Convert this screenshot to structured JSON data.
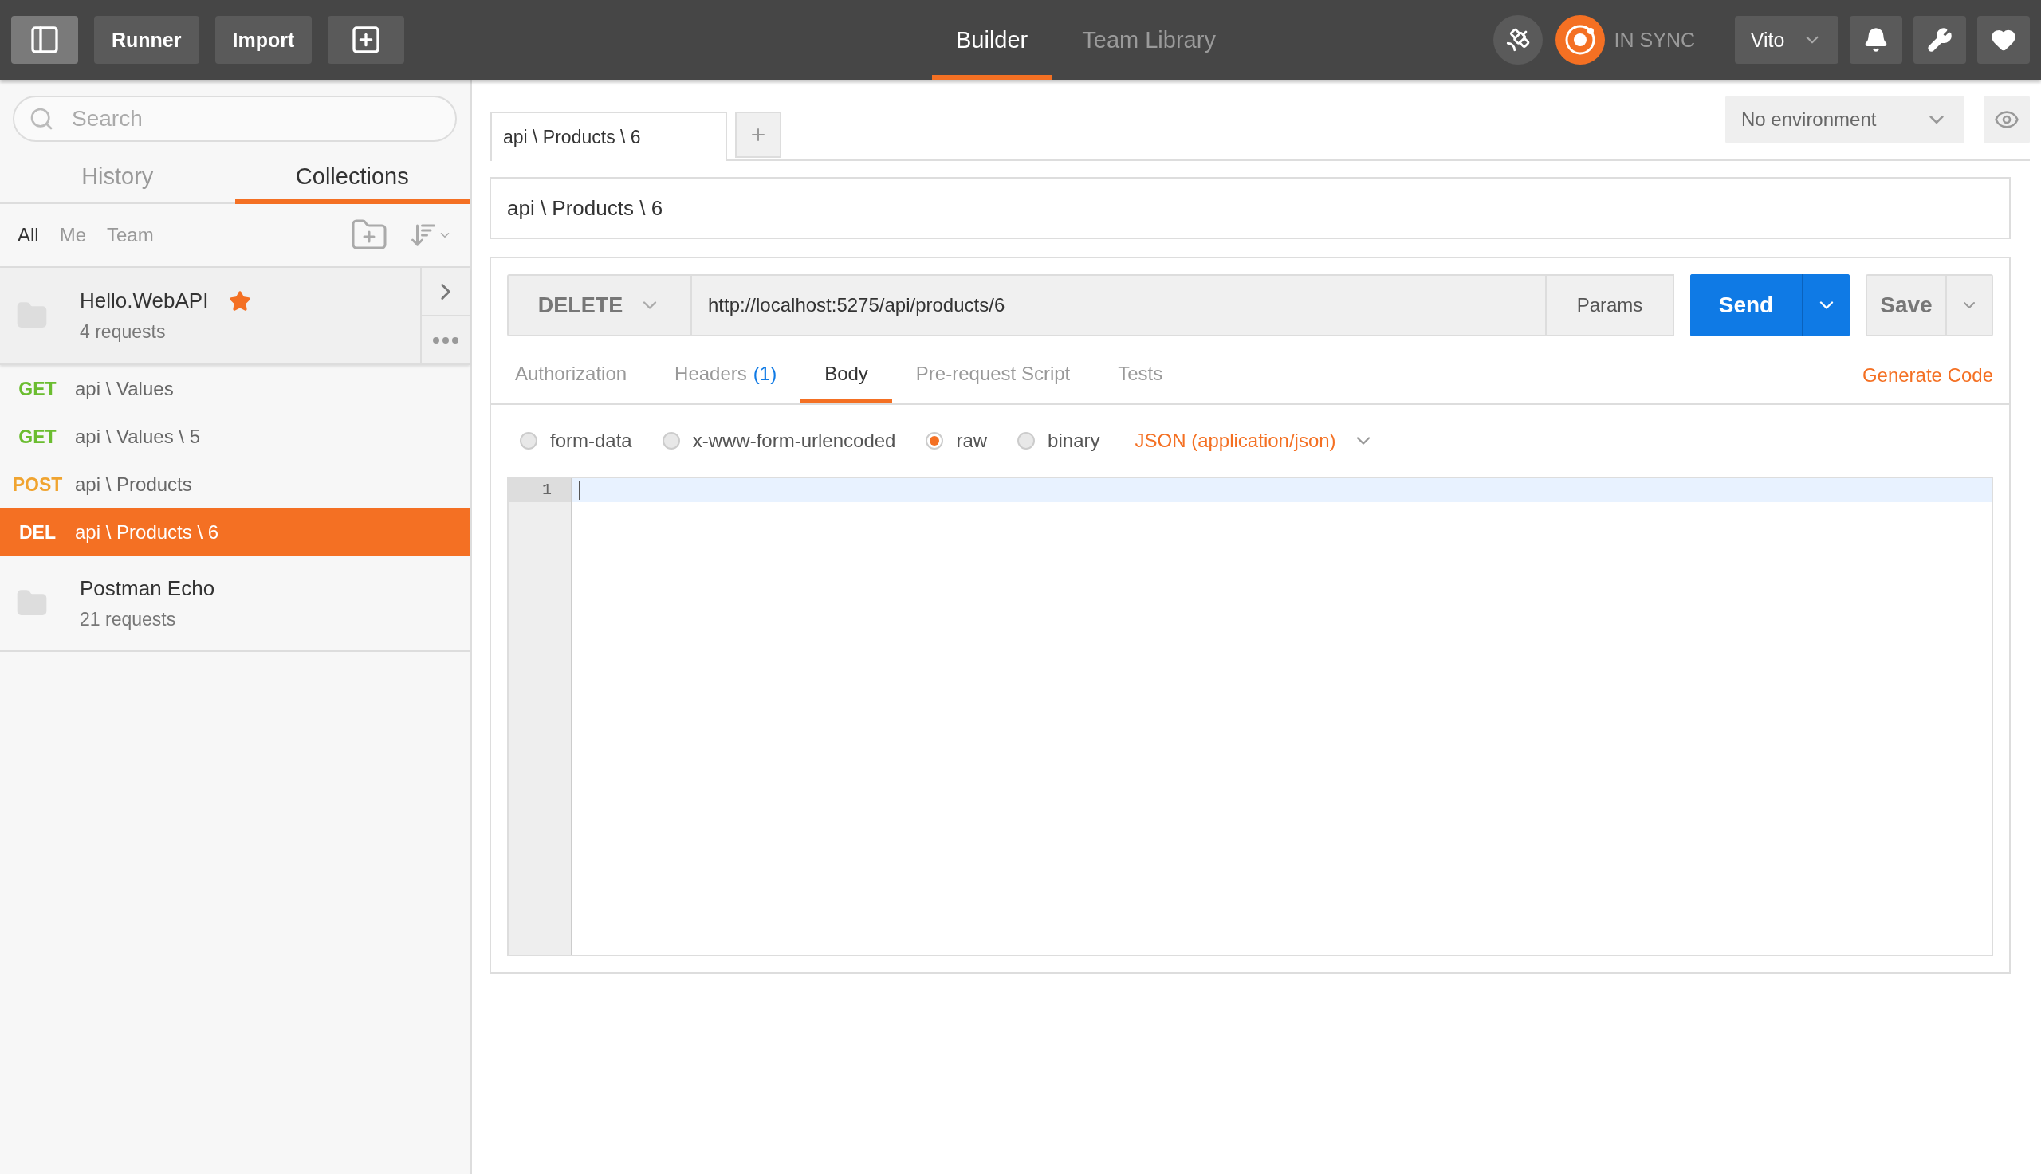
{
  "header": {
    "buttons": [
      {
        "kind": "toggle"
      },
      {
        "kind": "text",
        "label": "Runner"
      },
      {
        "kind": "text",
        "label": "Import"
      },
      {
        "kind": "new"
      }
    ],
    "tabs": [
      {
        "label": "Builder",
        "selected": true
      },
      {
        "label": "Team Library",
        "selected": false
      }
    ],
    "sync": {
      "label": "IN SYNC"
    },
    "user": "Vito"
  },
  "sidebar": {
    "search": {
      "placeholder": "Search"
    },
    "tabs": [
      {
        "label": "History",
        "selected": false
      },
      {
        "label": "Collections",
        "selected": true
      }
    ],
    "filters": [
      {
        "label": "All",
        "selected": true
      },
      {
        "label": "Me",
        "selected": false
      },
      {
        "label": "Team",
        "selected": false
      }
    ],
    "collections": [
      {
        "name": "Hello.WebAPI",
        "count": "4 requests",
        "starred": true,
        "expanded": true,
        "children": [
          {
            "method": "GET",
            "color": "#6bbd30",
            "name": "api \\ Values",
            "selected": false
          },
          {
            "method": "GET",
            "color": "#6bbd30",
            "name": "api \\ Values \\ 5",
            "selected": false
          },
          {
            "method": "POST",
            "color": "#f0a430",
            "name": "api \\ Products",
            "selected": false
          },
          {
            "method": "DEL",
            "color": "#ffffff",
            "name": "api \\ Products \\ 6",
            "selected": true
          }
        ]
      },
      {
        "name": "Postman Echo",
        "count": "21 requests",
        "starred": false,
        "expanded": false
      }
    ]
  },
  "main": {
    "tabs": [
      {
        "label": "api \\ Products \\ 6",
        "selected": true
      }
    ],
    "environment": "No environment",
    "title": "api \\ Products \\ 6",
    "request": {
      "method": "DELETE",
      "url": "http://localhost:5275/api/products/6",
      "params": "Params",
      "send": "Send",
      "save": "Save"
    },
    "request_tabs": [
      {
        "label": "Authorization",
        "selected": false
      },
      {
        "label": "Headers",
        "badge": "(1)",
        "selected": false
      },
      {
        "label": "Body",
        "selected": true
      },
      {
        "label": "Pre-request Script",
        "selected": false
      },
      {
        "label": "Tests",
        "selected": false
      }
    ],
    "generate_code": "Generate Code",
    "body_types": [
      {
        "label": "form-data",
        "selected": false
      },
      {
        "label": "x-www-form-urlencoded",
        "selected": false
      },
      {
        "label": "raw",
        "selected": true
      },
      {
        "label": "binary",
        "selected": false
      }
    ],
    "body_format": "JSON (application/json)",
    "line_numbers": [
      "1"
    ]
  }
}
